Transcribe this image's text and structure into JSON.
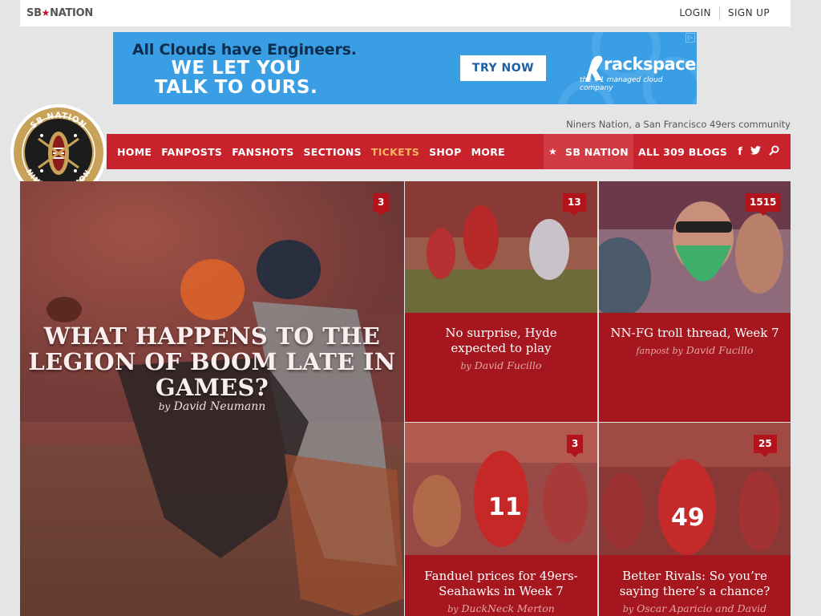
{
  "topbar": {
    "logo_text": "SB",
    "logo_star": "★",
    "logo_text2": "NATION",
    "login": "LOGIN",
    "signup": "SIGN UP"
  },
  "ad": {
    "headline": "All Clouds have Engineers.",
    "line1": "WE LET YOU",
    "line2": "TALK TO OURS.",
    "cta": "TRY NOW",
    "brand": "rackspace",
    "brand_tag": "the #1 managed cloud company",
    "choices_glyph": "▷",
    "bg_color": "#3a9ee4"
  },
  "site": {
    "tagline": "Niners Nation, a San Francisco 49ers community",
    "badge_top": "SB NATION",
    "badge_bottom": "NINERS NATION",
    "accent_color": "#c8232c"
  },
  "nav": {
    "items": [
      "HOME",
      "FANPOSTS",
      "FANSHOTS",
      "SECTIONS",
      "TICKETS",
      "SHOP",
      "MORE"
    ],
    "sbnation": "SB NATION",
    "sbnation_icon": "star-icon",
    "all_blogs": "ALL 309 BLOGS",
    "social": [
      "facebook-icon",
      "twitter-icon",
      "search-icon"
    ],
    "facebook_glyph": "f",
    "twitter_glyph": "t",
    "search_glyph": "⌕"
  },
  "featured": {
    "title": "WHAT HAPPENS TO THE LEGION OF BOOM LATE IN GAMES?",
    "by_prefix": "by",
    "author": "David Neumann",
    "comments": "3"
  },
  "stories": [
    {
      "title": "No surprise, Hyde expected to play",
      "by_prefix": "by",
      "author": "David Fucillo",
      "comments": "13"
    },
    {
      "title": "NN-FG troll thread, Week 7",
      "by_prefix": "fanpost by",
      "author": "David Fucillo",
      "comments": "1515"
    },
    {
      "title": "Fanduel prices for 49ers-Seahawks in Week 7",
      "by_prefix": "by",
      "author": "DuckNeck Merton",
      "comments": "3"
    },
    {
      "title": "Better Rivals: So you’re saying there’s a chance?",
      "by_prefix": "by",
      "author": "Oscar Aparicio and David",
      "comments": "25"
    }
  ]
}
